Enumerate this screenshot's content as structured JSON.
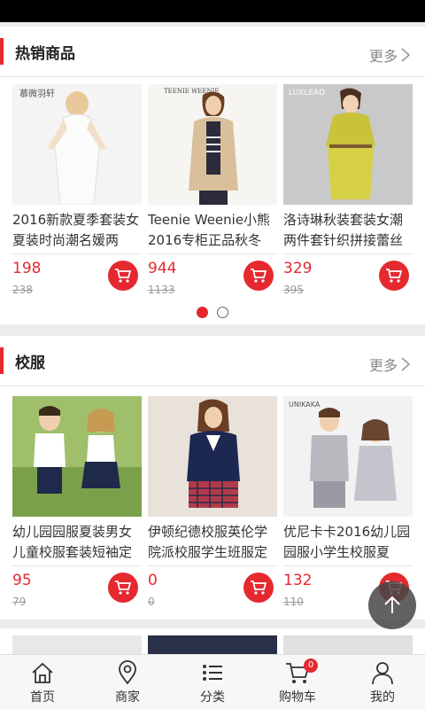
{
  "hot": {
    "title": "热销商品",
    "more": "更多",
    "products": [
      {
        "name": "2016新款夏季套装女夏装时尚潮名媛两",
        "price": "198",
        "old_price": "238",
        "brand": "慕微羽轩"
      },
      {
        "name": "Teenie Weenie小熊2016专柜正品秋冬",
        "price": "944",
        "old_price": "1133",
        "brand": "TEENIE WEENIE"
      },
      {
        "name": "洛诗琳秋装套装女潮两件套针织拼接蕾丝",
        "price": "329",
        "old_price": "395",
        "brand": "LUXLEAD"
      }
    ],
    "pages": 2,
    "active_page": 1
  },
  "uniform": {
    "title": "校服",
    "more": "更多",
    "products": [
      {
        "name": "幼儿园园服夏装男女儿童校服套装短袖定",
        "price": "95",
        "old_price": "79"
      },
      {
        "name": "伊顿纪德校服英伦学院派校服学生班服定",
        "price": "0",
        "old_price": "0"
      },
      {
        "name": "优尼卡卡2016幼儿园园服小学生校服夏",
        "price": "132",
        "old_price": "110",
        "brand": "UNIKAKA"
      }
    ]
  },
  "tabbar": {
    "items": [
      {
        "label": "首页",
        "icon": "home-icon"
      },
      {
        "label": "商家",
        "icon": "location-pin-icon"
      },
      {
        "label": "分类",
        "icon": "list-icon"
      },
      {
        "label": "购物车",
        "icon": "cart-icon",
        "badge": "0"
      },
      {
        "label": "我的",
        "icon": "user-icon"
      }
    ]
  },
  "colors": {
    "accent": "#e4292f",
    "background": "#ececec"
  }
}
